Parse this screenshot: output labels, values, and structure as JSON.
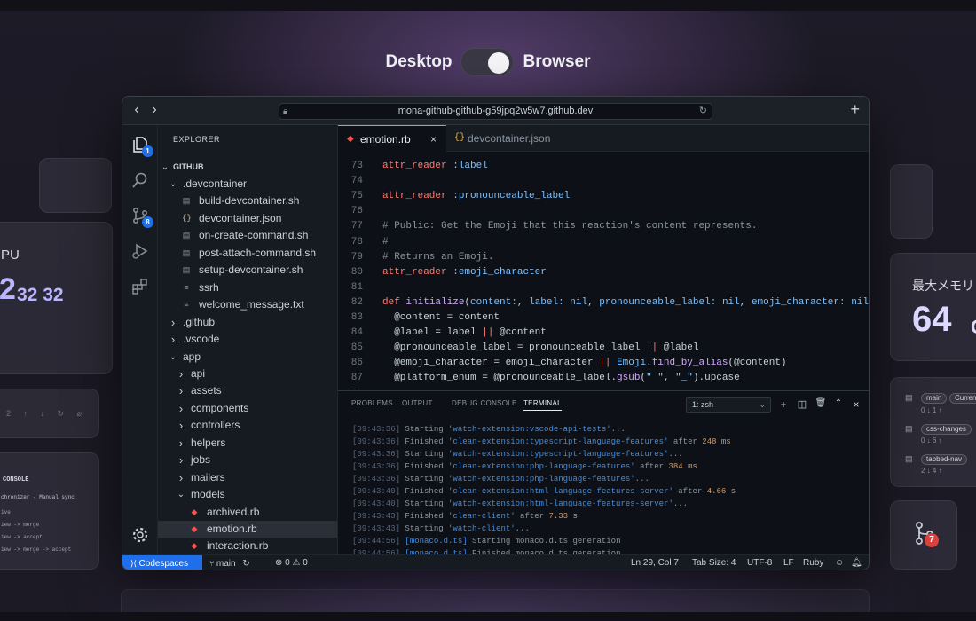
{
  "toggle": {
    "left_label": "Desktop",
    "right_label": "Browser",
    "state": "Browser"
  },
  "left_cards": {
    "cpu_label": "PU",
    "cpu_big": "2",
    "cpu_values": "32 32",
    "console_title": "CONSOLE",
    "console_lines": [
      "chronizer - Manual sync",
      "ive",
      "iew -> merge",
      "iew -> accept",
      "iew -> merge -> accept"
    ]
  },
  "right_cards": {
    "memory_label": "最大メモリ",
    "memory_value": "64",
    "memory_suffix": "G",
    "branches": [
      {
        "name": "main",
        "tag": "Current",
        "counts": "0 ↓ 1 ↑"
      },
      {
        "name": "css-changes",
        "tag": "",
        "counts": "0 ↓ 6 ↑"
      },
      {
        "name": "tabbed-nav",
        "tag": "",
        "counts": "2 ↓ 4 ↑"
      }
    ],
    "pr_badge": "7"
  },
  "browser": {
    "url": "mona-github-github-g59jpq2w5w7.github.dev"
  },
  "activity_bar": {
    "explorer_badge": "1",
    "scm_badge": "8",
    "icons": [
      "files-icon",
      "search-icon",
      "source-control-icon",
      "run-debug-icon",
      "extensions-icon",
      "settings-gear-icon"
    ]
  },
  "explorer": {
    "title": "EXPLORER",
    "root": "GITHUB",
    "items": [
      {
        "label": ".devcontainer",
        "type": "folder-open",
        "depth": 1
      },
      {
        "label": "build-devcontainer.sh",
        "type": "file-sh",
        "depth": 2
      },
      {
        "label": "devcontainer.json",
        "type": "file-json",
        "depth": 2
      },
      {
        "label": "on-create-command.sh",
        "type": "file-sh",
        "depth": 2
      },
      {
        "label": "post-attach-command.sh",
        "type": "file-sh",
        "depth": 2
      },
      {
        "label": "setup-devcontainer.sh",
        "type": "file-sh",
        "depth": 2
      },
      {
        "label": "ssrh",
        "type": "file-txt",
        "depth": 2
      },
      {
        "label": "welcome_message.txt",
        "type": "file-txt",
        "depth": 2
      },
      {
        "label": ".github",
        "type": "folder",
        "depth": 1
      },
      {
        "label": ".vscode",
        "type": "folder",
        "depth": 1
      },
      {
        "label": "app",
        "type": "folder-open",
        "depth": 1
      },
      {
        "label": "api",
        "type": "folder",
        "depth": 2
      },
      {
        "label": "assets",
        "type": "folder",
        "depth": 2
      },
      {
        "label": "components",
        "type": "folder",
        "depth": 2
      },
      {
        "label": "controllers",
        "type": "folder",
        "depth": 2
      },
      {
        "label": "helpers",
        "type": "folder",
        "depth": 2
      },
      {
        "label": "jobs",
        "type": "folder",
        "depth": 2
      },
      {
        "label": "mailers",
        "type": "folder",
        "depth": 2
      },
      {
        "label": "models",
        "type": "folder-open",
        "depth": 2
      },
      {
        "label": "archived.rb",
        "type": "file-rb",
        "depth": 3
      },
      {
        "label": "emotion.rb",
        "type": "file-rb",
        "depth": 3,
        "selected": true
      },
      {
        "label": "interaction.rb",
        "type": "file-rb",
        "depth": 3
      }
    ]
  },
  "tabs": [
    {
      "label": "emotion.rb",
      "active": true,
      "icon": "ruby-icon"
    },
    {
      "label": "devcontainer.json",
      "active": false,
      "icon": "json-icon"
    }
  ],
  "code_lines": [
    {
      "n": "73",
      "html": "<span class=\"k\">attr_reader</span> <span class=\"s\">:label</span>"
    },
    {
      "n": "74",
      "html": ""
    },
    {
      "n": "75",
      "html": "<span class=\"k\">attr_reader</span> <span class=\"s\">:pronounceable_label</span>"
    },
    {
      "n": "76",
      "html": ""
    },
    {
      "n": "77",
      "html": "<span class=\"c\"># Public: Get the Emoji that this reaction's content represents.</span>"
    },
    {
      "n": "78",
      "html": "<span class=\"c\">#</span>"
    },
    {
      "n": "79",
      "html": "<span class=\"c\"># Returns an Emoji.</span>"
    },
    {
      "n": "80",
      "html": "<span class=\"k\">attr_reader</span> <span class=\"s\">:emoji_character</span>"
    },
    {
      "n": "81",
      "html": ""
    },
    {
      "n": "82",
      "html": "<span class=\"k\">def</span> <span class=\"f\">initialize</span>(<span class=\"s\">content:</span>, <span class=\"s\">label:</span> <span class=\"s\">nil</span>, <span class=\"s\">pronounceable_label:</span> <span class=\"s\">nil</span>, <span class=\"s\">emoji_character:</span> <span class=\"s\">nil</span>)"
    },
    {
      "n": "83",
      "html": "  @content = content"
    },
    {
      "n": "84",
      "html": "  @label = label <span class=\"k\">||</span> @content"
    },
    {
      "n": "85",
      "html": "  @pronounceable_label = pronounceable_label <span class=\"k\">||</span> @label"
    },
    {
      "n": "86",
      "html": "  @emoji_character = emoji_character <span class=\"k\">||</span> <span class=\"s\">Emoji</span>.<span class=\"f\">find_by_alias</span>(@content)"
    },
    {
      "n": "87",
      "html": "  @platform_enum = @pronounceable_label.<span class=\"f\">gsub</span>(<span class=\"st\">\" \"</span>, <span class=\"st\">\"_\"</span>).upcase"
    },
    {
      "n": "87",
      "html": ""
    }
  ],
  "panel": {
    "tabs": [
      "PROBLEMS",
      "OUTPUT",
      "DEBUG CONSOLE",
      "TERMINAL"
    ],
    "active_tab": "TERMINAL",
    "terminal_select": "1: zsh",
    "lines": [
      {
        "t": "[09:43:36]",
        "pre": " Starting ",
        "q": "'watch-extension:vscode-api-tests'",
        "post": "...",
        "v": ""
      },
      {
        "t": "[09:43:36]",
        "pre": " Finished ",
        "q": "'clean-extension:typescript-language-features'",
        "post": " after ",
        "v": "248 ms"
      },
      {
        "t": "[09:43:36]",
        "pre": " Starting ",
        "q": "'watch-extension:typescript-language-features'",
        "post": "...",
        "v": ""
      },
      {
        "t": "[09:43:36]",
        "pre": " Finished ",
        "q": "'clean-extension:php-language-features'",
        "post": " after ",
        "v": "384 ms"
      },
      {
        "t": "[09:43:36]",
        "pre": " Starting ",
        "q": "'watch-extension:php-language-features'",
        "post": "...",
        "v": ""
      },
      {
        "t": "[09:43:40]",
        "pre": " Finished ",
        "q": "'clean-extension:html-language-features-server'",
        "post": " after ",
        "v": "4.66 s"
      },
      {
        "t": "[09:43:40]",
        "pre": " Starting ",
        "q": "'watch-extension:html-language-features-server'",
        "post": "...",
        "v": ""
      },
      {
        "t": "[09:43:43]",
        "pre": " Finished ",
        "q": "'clean-client'",
        "post": " after ",
        "v": "7.33 s"
      },
      {
        "t": "[09:43:43]",
        "pre": " Starting ",
        "q": "'watch-client'",
        "post": "...",
        "v": ""
      },
      {
        "t": "[09:44:56]",
        "pre": " ",
        "q": "[monaco.d.ts]",
        "post": " Starting monaco.d.ts generation",
        "v": ""
      },
      {
        "t": "[09:44:56]",
        "pre": " ",
        "q": "[monaco.d.ts]",
        "post": " Finished monaco.d.ts generation",
        "v": ""
      }
    ]
  },
  "status": {
    "remote": "Codespaces",
    "branch": "main",
    "problems": "⊗ 0 ⚠ 0",
    "position": "Ln 29, Col 7",
    "tab_size": "Tab Size: 4",
    "encoding": "UTF-8",
    "eol": "LF",
    "language": "Ruby"
  }
}
